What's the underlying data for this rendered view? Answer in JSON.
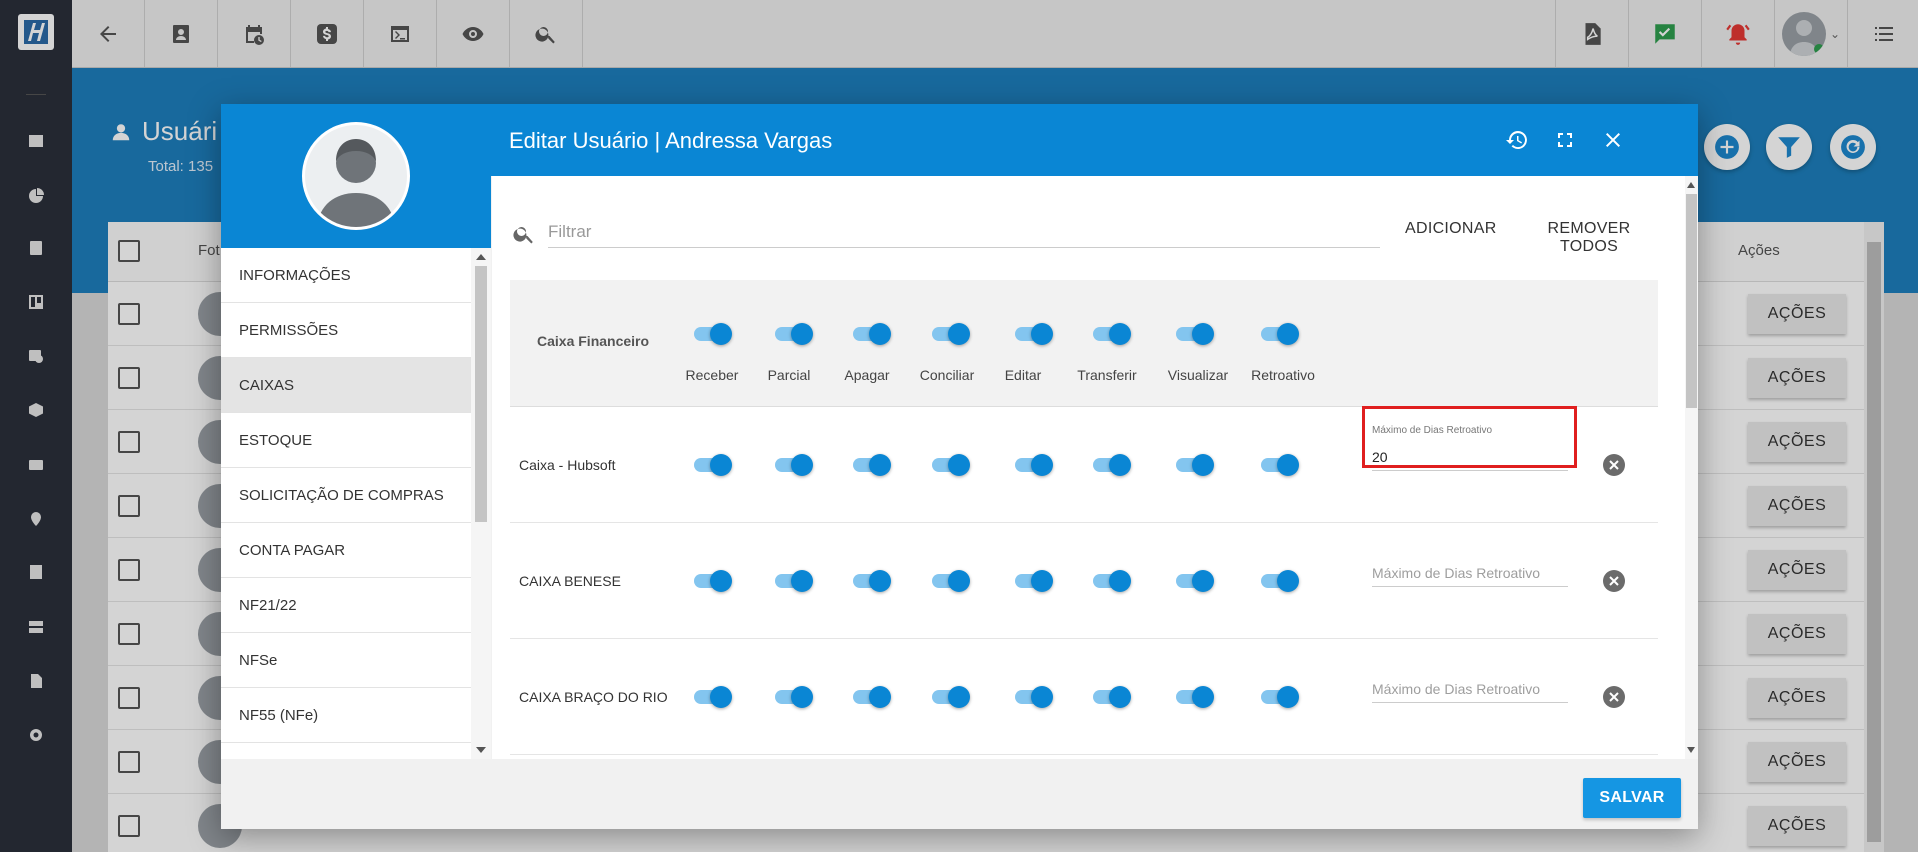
{
  "topbar": {
    "left_icons": [
      "arrow-left-icon",
      "contact-card-icon",
      "calendar-clock-icon",
      "dollar-icon",
      "terminal-icon",
      "eye-icon",
      "search-icon"
    ],
    "right_icons": [
      "pdf-icon",
      "chat-check-icon",
      "alarm-bell-icon",
      "user-avatar",
      "list-menu-icon"
    ],
    "accent_green": "#2e9e4f",
    "accent_red": "#e53935"
  },
  "page": {
    "title": "Usuári",
    "total": "Total: 135",
    "columns": {
      "foto": "Fot",
      "acoes": "Ações"
    },
    "row_action_label": "AÇÕES"
  },
  "modal": {
    "title": "Editar Usuário | Andressa Vargas",
    "menu": [
      {
        "label": "INFORMAÇÕES",
        "active": false
      },
      {
        "label": "PERMISSÕES",
        "active": false
      },
      {
        "label": "CAIXAS",
        "active": true
      },
      {
        "label": "ESTOQUE",
        "active": false
      },
      {
        "label": "SOLICITAÇÃO DE COMPRAS",
        "active": false
      },
      {
        "label": "CONTA PAGAR",
        "active": false
      },
      {
        "label": "NF21/22",
        "active": false
      },
      {
        "label": "NFSe",
        "active": false
      },
      {
        "label": "NF55 (NFe)",
        "active": false
      }
    ],
    "filter": {
      "placeholder": "Filtrar",
      "value": ""
    },
    "add_label": "ADICIONAR",
    "remove_all_label": "REMOVER TODOS",
    "header_row": {
      "label": "Caixa Financeiro",
      "columns": [
        "Receber",
        "Parcial",
        "Apagar",
        "Conciliar",
        "Editar",
        "Transferir",
        "Visualizar",
        "Retroativo"
      ]
    },
    "rows": [
      {
        "label": "Caixa - Hubsoft",
        "dias_label": "Máximo de Dias Retroativo",
        "dias_value": "20",
        "dias_placeholder": ""
      },
      {
        "label": "CAIXA BENESE",
        "dias_label": "",
        "dias_value": "",
        "dias_placeholder": "Máximo de Dias Retroativo"
      },
      {
        "label": "CAIXA BRAÇO DO RIO",
        "dias_label": "",
        "dias_value": "",
        "dias_placeholder": "Máximo de Dias Retroativo"
      }
    ],
    "save_label": "SALVAR",
    "toggle_color": "#0a86d4",
    "header_color": "#0a86d4"
  }
}
